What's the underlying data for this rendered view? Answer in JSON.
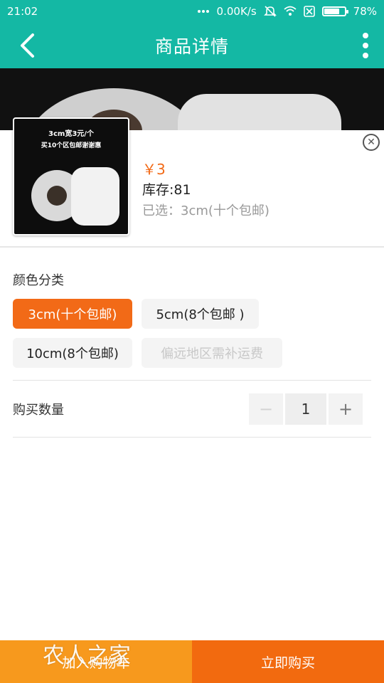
{
  "status_bar": {
    "time": "21:02",
    "network_speed": "0.00K/s",
    "battery": "78%",
    "battery_level": 0.78,
    "icons": [
      "dots-icon",
      "mute-icon",
      "wifi-icon",
      "sim-icon",
      "battery-icon"
    ]
  },
  "header": {
    "title": "商品详情",
    "back_icon": "chevron-left-icon",
    "more_icon": "more-vertical-icon"
  },
  "product": {
    "price": "￥3",
    "stock": "库存:81",
    "selected": "已选：3cm(十个包邮)",
    "thumb_line1": "3cm宽3元/个",
    "thumb_line2": "买10个区包邮谢谢惠"
  },
  "color_section": {
    "title": "颜色分类",
    "options": [
      {
        "label": "3cm(十个包邮)",
        "state": "selected"
      },
      {
        "label": "5cm(8个包邮 )",
        "state": "normal"
      },
      {
        "label": "10cm(8个包邮)",
        "state": "normal"
      },
      {
        "label": "偏远地区需补运费",
        "state": "disabled"
      }
    ]
  },
  "quantity": {
    "label": "购买数量",
    "value": "1",
    "minus": "−",
    "plus": "+"
  },
  "bottom_bar": {
    "add_to_cart": "加入购物车",
    "buy_now": "立即购买",
    "watermark": "农人之家"
  },
  "colors": {
    "header_bg": "#14b8a4",
    "accent_orange": "#f26a17",
    "cart_bg": "#f7991d"
  }
}
